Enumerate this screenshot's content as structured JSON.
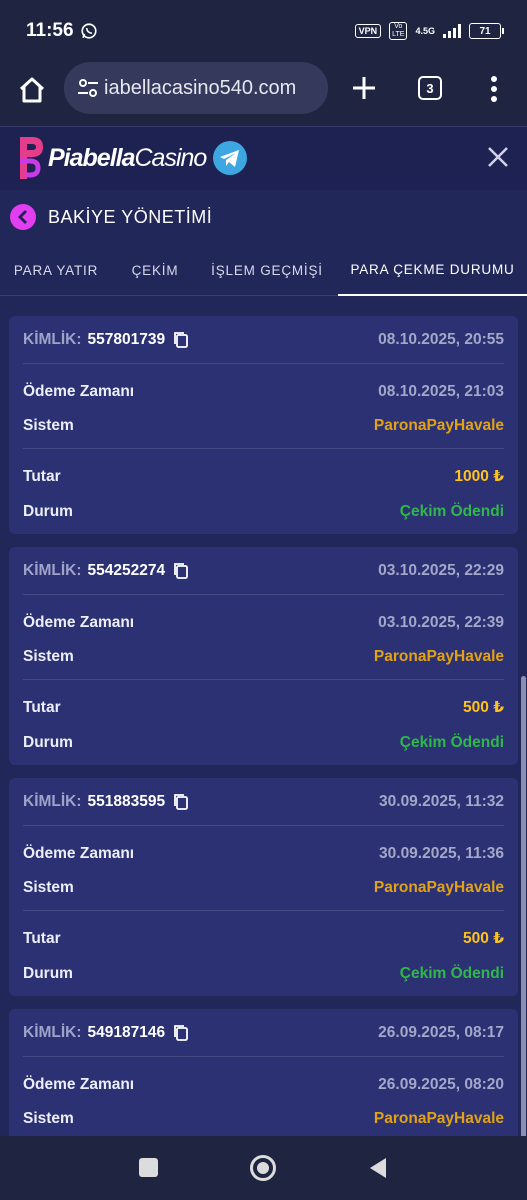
{
  "status_bar": {
    "time": "11:56",
    "vpn": "VPN",
    "volte_top": "Vo",
    "volte_bottom": "LTE",
    "network": "4.5G",
    "battery": "71"
  },
  "browser": {
    "url": "iabellacasino540.com",
    "tab_count": "3"
  },
  "site": {
    "logo_bold": "Piabella",
    "logo_light": "Casino"
  },
  "page_title": "BAKİYE YÖNETİMİ",
  "tabs": [
    {
      "label": "PARA YATIR"
    },
    {
      "label": "ÇEKİM"
    },
    {
      "label": "İŞLEM GEÇMİŞİ"
    },
    {
      "label": "PARA ÇEKME DURUMU"
    }
  ],
  "labels": {
    "id": "KİMLİK:",
    "payment_time": "Ödeme Zamanı",
    "system": "Sistem",
    "amount": "Tutar",
    "status": "Durum"
  },
  "transactions": [
    {
      "id": "557801739",
      "created": "08.10.2025, 20:55",
      "payment_time": "08.10.2025, 21:03",
      "system": "ParonaPayHavale",
      "amount": "1000 ₺",
      "status": "Çekim Ödendi"
    },
    {
      "id": "554252274",
      "created": "03.10.2025, 22:29",
      "payment_time": "03.10.2025, 22:39",
      "system": "ParonaPayHavale",
      "amount": "500 ₺",
      "status": "Çekim Ödendi"
    },
    {
      "id": "551883595",
      "created": "30.09.2025, 11:32",
      "payment_time": "30.09.2025, 11:36",
      "system": "ParonaPayHavale",
      "amount": "500 ₺",
      "status": "Çekim Ödendi"
    },
    {
      "id": "549187146",
      "created": "26.09.2025, 08:17",
      "payment_time": "26.09.2025, 08:20",
      "system": "ParonaPayHavale",
      "amount": "",
      "status": ""
    }
  ],
  "colors": {
    "background": "#22275a",
    "card": "#2c3173",
    "accent": "#e33df0",
    "system": "#e2a215",
    "amount": "#ffc21a",
    "success": "#2fb84a"
  }
}
